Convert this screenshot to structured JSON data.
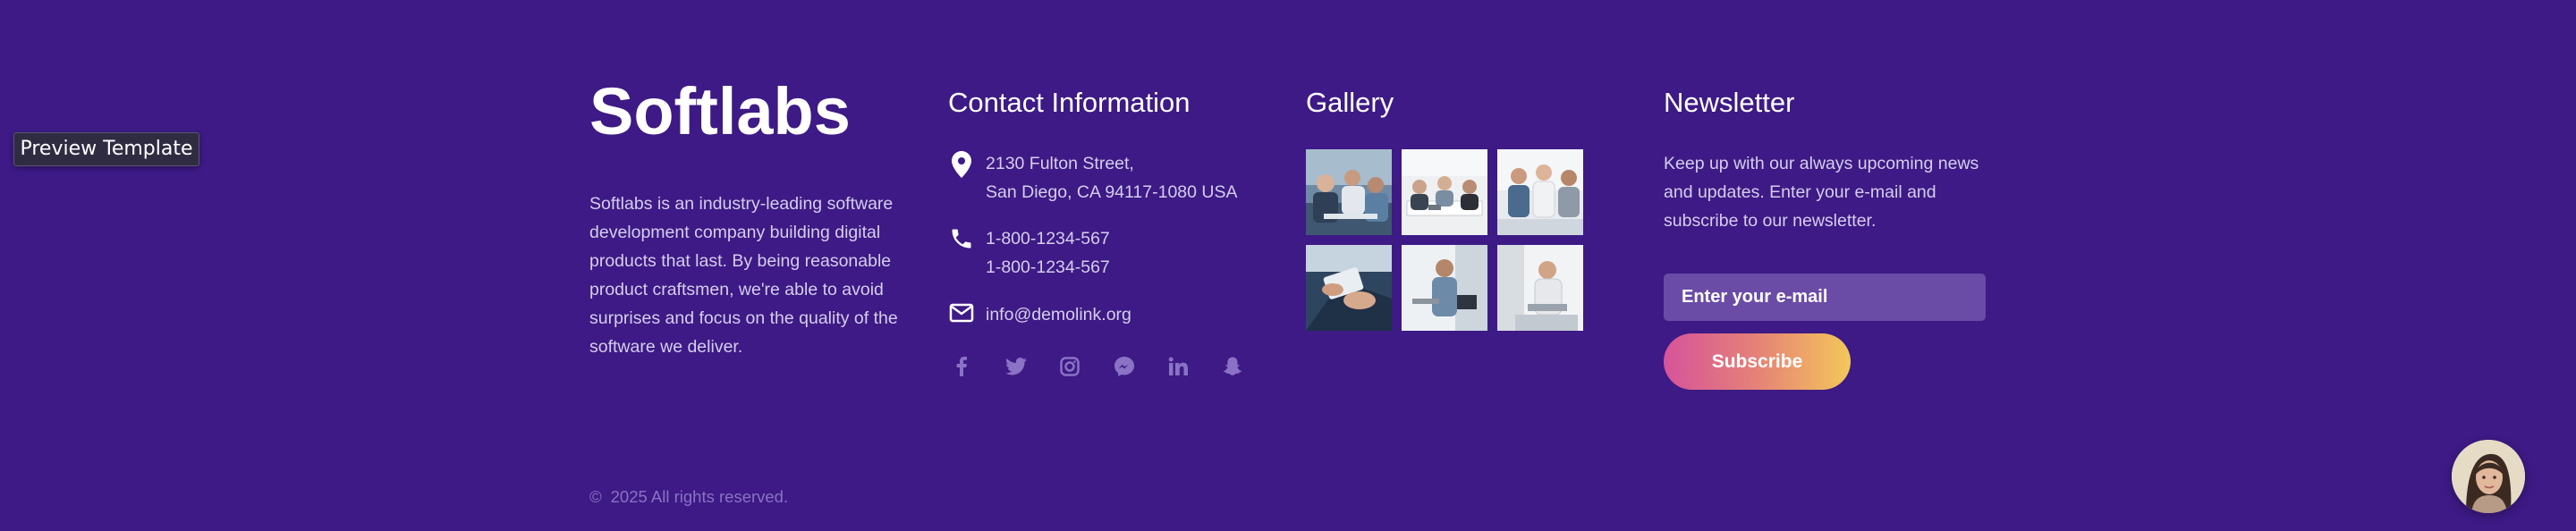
{
  "preview": {
    "label": "Preview Template"
  },
  "brand": {
    "name": "Softlabs"
  },
  "about": {
    "text": "Softlabs is an industry-leading software development company building digital products that last. By being reasonable product craftsmen, we're able to avoid surprises and focus on the quality of the software we deliver."
  },
  "contact": {
    "title": "Contact Information",
    "address_line1": "2130 Fulton Street,",
    "address_line2": "San Diego, CA 94117-1080 USA",
    "phone1": "1-800-1234-567",
    "phone2": "1-800-1234-567",
    "email": "info@demolink.org",
    "socials": [
      "facebook-icon",
      "twitter-icon",
      "instagram-icon",
      "messenger-icon",
      "linkedin-icon",
      "snapchat-icon"
    ]
  },
  "gallery": {
    "title": "Gallery"
  },
  "newsletter": {
    "title": "Newsletter",
    "text": "Keep up with our always upcoming news and updates. Enter your e-mail and subscribe to our newsletter.",
    "placeholder": "Enter your e-mail",
    "button": "Subscribe"
  },
  "footer": {
    "copyright_symbol": "©",
    "copyright_text": "2025 All rights reserved."
  },
  "colors": {
    "background": "#3d1a85",
    "muted_text": "#d6cdec",
    "icon_muted": "#8a72c4",
    "input_bg": "#6a4ca7",
    "gradient_start": "#d6539a",
    "gradient_end": "#f4c759"
  }
}
